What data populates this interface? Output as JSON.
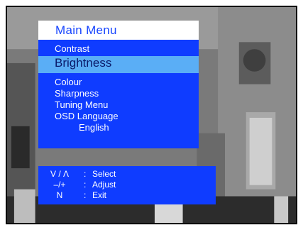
{
  "menu": {
    "title": "Main Menu",
    "items": [
      {
        "label": "Contrast"
      },
      {
        "label": "Brightness",
        "selected": true
      },
      {
        "label": "Colour"
      },
      {
        "label": "Sharpness"
      },
      {
        "label": "Tuning Menu"
      },
      {
        "label": "OSD Language"
      }
    ],
    "language_value": "English"
  },
  "help": {
    "rows": [
      {
        "key": "V / Λ",
        "action": "Select"
      },
      {
        "key": "–/+",
        "action": "Adjust"
      },
      {
        "key": "N",
        "action": "Exit"
      }
    ],
    "separator": ":"
  },
  "colors": {
    "menu_blue": "#0f3cff",
    "highlight": "#5aaef6",
    "title_bar": "#ffffff"
  }
}
